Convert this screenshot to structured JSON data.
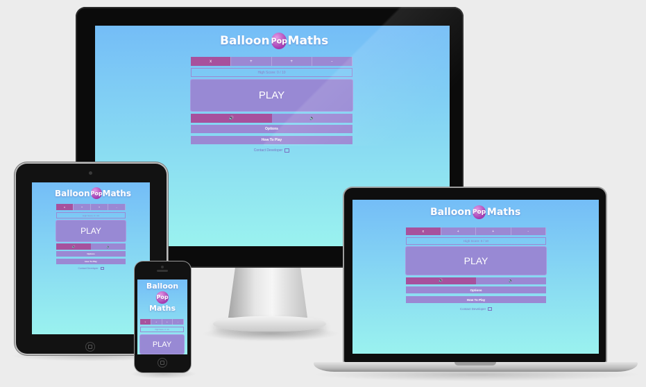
{
  "app": {
    "logo_left": "Balloon",
    "logo_mid": "Pop",
    "logo_right": "Maths",
    "difficulty": [
      "x",
      "+",
      "+",
      "-"
    ],
    "high_score": "High Score: 0 / 10",
    "play_label": "PLAY",
    "sound_on_icon": "speaker-on-icon",
    "sound_off_icon": "speaker-off-icon",
    "sound_on_glyph": "🔊",
    "sound_off_glyph": "🔈",
    "options_label": "Options",
    "howto_label": "How To Play",
    "contact_label": "Contact Developer"
  },
  "colors": {
    "background_top": "#74bdf7",
    "background_bottom": "#9af2ef",
    "button": "#9b88d3",
    "active": "#a7519d"
  }
}
